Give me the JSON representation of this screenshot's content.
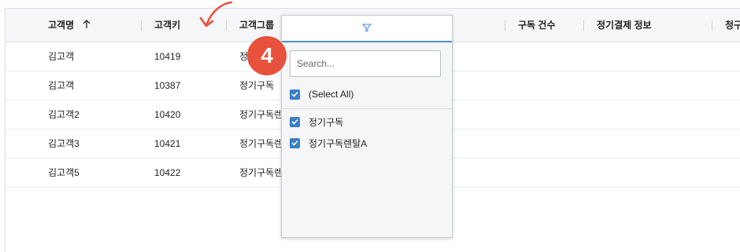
{
  "columns": [
    {
      "label": "고객명",
      "sort_icon": "arrow-up-icon"
    },
    {
      "label": "고객키"
    },
    {
      "label": "고객그룹"
    },
    {
      "label": "구독 건수"
    },
    {
      "label": "정기결제 정보"
    },
    {
      "label": "청구"
    }
  ],
  "rows": [
    {
      "name": "김고객",
      "key": "10419",
      "group": "정"
    },
    {
      "name": "김고객",
      "key": "10387",
      "group": "정기구독"
    },
    {
      "name": "김고객2",
      "key": "10420",
      "group": "정기구독렌"
    },
    {
      "name": "김고객3",
      "key": "10421",
      "group": "정기구독렌"
    },
    {
      "name": "김고객5",
      "key": "10422",
      "group": "정기구독렌"
    }
  ],
  "filter": {
    "icon": "filter-icon",
    "search_placeholder": "Search...",
    "select_all_label": "(Select All)",
    "options": [
      {
        "label": "정기구독",
        "checked": true
      },
      {
        "label": "정기구독렌탈A",
        "checked": true
      }
    ]
  },
  "annotation": {
    "step_number": "4",
    "arrow": "red-curved-arrow-icon"
  },
  "colors": {
    "accent": "#4a90d9",
    "checkbox": "#3a7ec4",
    "badge": "#e8513b",
    "header_bg": "#f6f7f9"
  }
}
